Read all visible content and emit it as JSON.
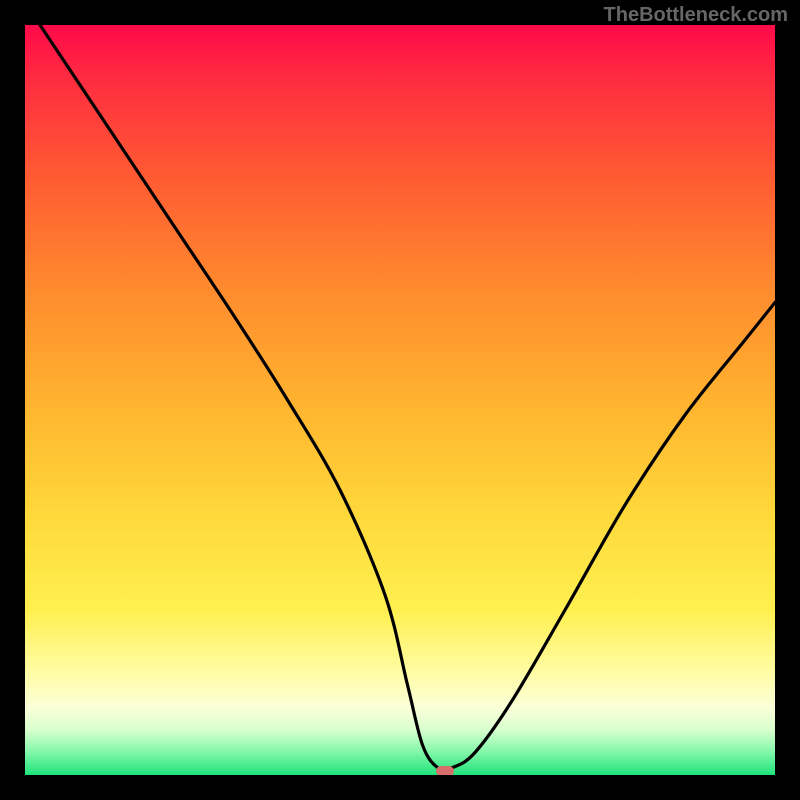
{
  "attribution": "TheBottleneck.com",
  "chart_data": {
    "type": "line",
    "title": "",
    "xlabel": "",
    "ylabel": "",
    "xlim": [
      0,
      100
    ],
    "ylim": [
      0,
      100
    ],
    "grid": false,
    "legend": false,
    "series": [
      {
        "name": "bottleneck-curve",
        "x": [
          2,
          10,
          20,
          28,
          35,
          42,
          48,
          51,
          53,
          55,
          57,
          60,
          65,
          72,
          80,
          88,
          96,
          100
        ],
        "y": [
          100,
          88,
          73,
          61,
          50,
          38,
          24,
          12,
          4,
          1,
          1,
          3,
          10,
          22,
          36,
          48,
          58,
          63
        ]
      }
    ],
    "annotations": [
      {
        "name": "optimal-marker",
        "x": 56,
        "y": 0.5
      }
    ],
    "background_gradient": {
      "top": "#ff0a4a",
      "bottom": "#1ee27a",
      "meaning": "red=high-bottleneck, green=optimal"
    }
  }
}
